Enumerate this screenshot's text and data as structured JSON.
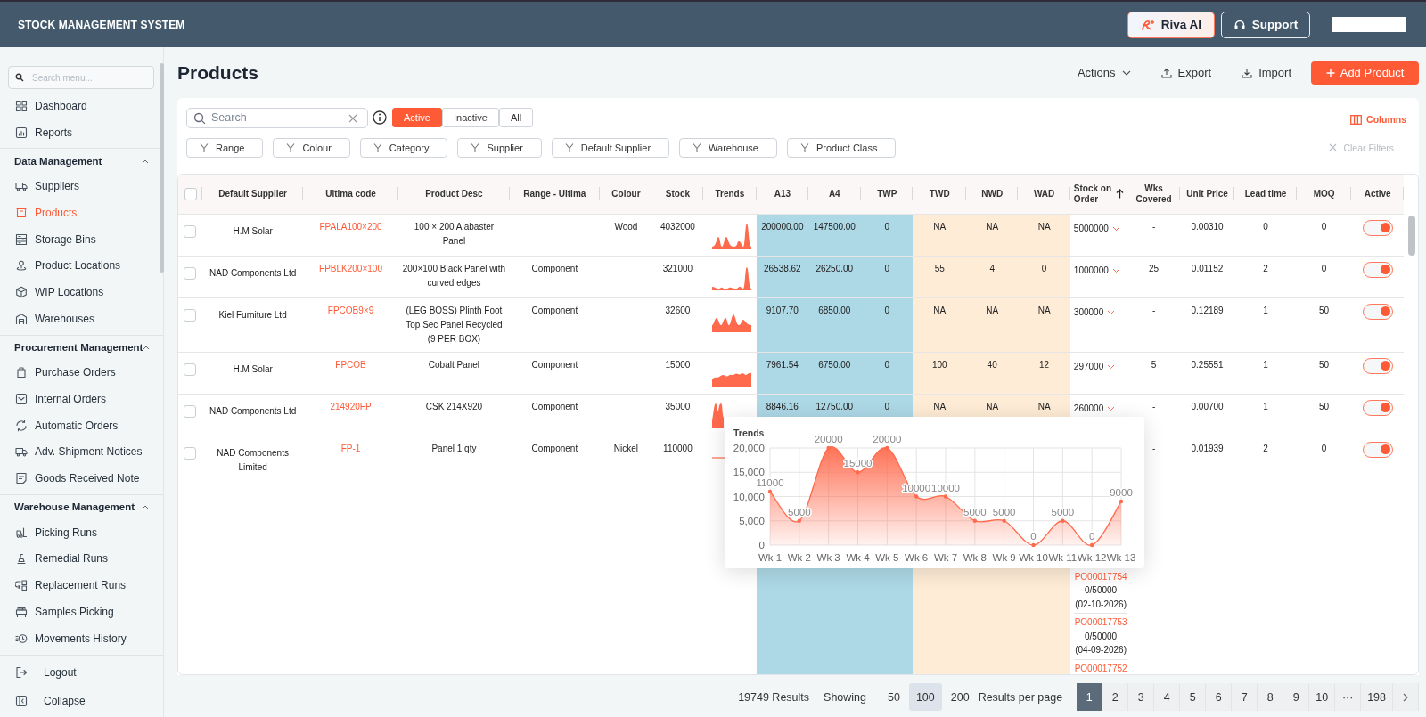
{
  "header": {
    "title": "STOCK MANAGEMENT SYSTEM",
    "buttons": [
      {
        "label": "Riva AI",
        "kind": "ai"
      },
      {
        "label": "Support",
        "kind": "support"
      }
    ]
  },
  "sidebar": {
    "search": {
      "placeholder": "Search menu..."
    },
    "items": [
      {
        "label": "Dashboard",
        "selected": false
      },
      {
        "label": "Reports",
        "selected": false
      }
    ],
    "sections": [
      {
        "title": "Data Management",
        "expanded": true,
        "items": [
          {
            "label": "Suppliers",
            "selected": false
          },
          {
            "label": "Products",
            "selected": true
          },
          {
            "label": "Storage Bins",
            "selected": false
          },
          {
            "label": "Product Locations",
            "selected": false
          },
          {
            "label": "WIP Locations",
            "selected": false
          },
          {
            "label": "Warehouses",
            "selected": false
          }
        ]
      },
      {
        "title": "Procurement Management",
        "expanded": true,
        "items": [
          {
            "label": "Purchase Orders",
            "selected": false
          },
          {
            "label": "Internal Orders",
            "selected": false
          },
          {
            "label": "Automatic Orders",
            "selected": false
          },
          {
            "label": "Adv. Shipment Notices",
            "selected": false
          },
          {
            "label": "Goods Received Note",
            "selected": false
          }
        ]
      },
      {
        "title": "Warehouse Management",
        "expanded": true,
        "items": [
          {
            "label": "Picking Runs",
            "selected": false
          },
          {
            "label": "Remedial Runs",
            "selected": false
          },
          {
            "label": "Replacement Runs",
            "selected": false
          },
          {
            "label": "Samples Picking",
            "selected": false
          },
          {
            "label": "Movements History",
            "selected": false
          }
        ]
      }
    ],
    "footer": [
      "Logout",
      "Collapse"
    ]
  },
  "page": {
    "title": "Products",
    "actions": [
      {
        "label": "Actions",
        "kind": "dropdown"
      },
      {
        "label": "Export",
        "kind": "export"
      },
      {
        "label": "Import",
        "kind": "import"
      },
      {
        "label": "Add Product",
        "kind": "primary"
      }
    ]
  },
  "filters": {
    "search": {
      "placeholder": "Search"
    },
    "status_tabs": [
      {
        "label": "Active",
        "selected": true
      },
      {
        "label": "Inactive",
        "selected": false
      },
      {
        "label": "All",
        "selected": false
      }
    ],
    "columns_label": "Columns",
    "chips": [
      "Range",
      "Colour",
      "Category",
      "Supplier",
      "Default Supplier",
      "Warehouse",
      "Product Class"
    ],
    "clear": {
      "label": "Clear Filters",
      "disabled": true
    }
  },
  "table": {
    "all_checked": false,
    "columns": [
      {
        "label": "Default Supplier",
        "kind": "text"
      },
      {
        "label": "Ultima code",
        "kind": "link"
      },
      {
        "label": "Product Desc",
        "kind": "text"
      },
      {
        "label": "Range - Ultima",
        "kind": "text"
      },
      {
        "label": "Colour",
        "kind": "text"
      },
      {
        "label": "Stock",
        "kind": "text"
      },
      {
        "label": "Trends",
        "kind": "trend"
      },
      {
        "label": "A13",
        "kind": "text",
        "color": "#add8e6"
      },
      {
        "label": "A4",
        "kind": "text",
        "color": "#add8e6"
      },
      {
        "label": "TWP",
        "kind": "text",
        "color": "#add8e6"
      },
      {
        "label": "TWD",
        "kind": "text",
        "color": "#feecd6"
      },
      {
        "label": "NWD",
        "kind": "text",
        "color": "#feecd6"
      },
      {
        "label": "WAD",
        "kind": "text",
        "color": "#feecd6"
      },
      {
        "label": "Stock on Order",
        "kind": "order",
        "sorted": true
      },
      {
        "label": "Wks Covered",
        "kind": "text"
      },
      {
        "label": "Unit Price",
        "kind": "text"
      },
      {
        "label": "Lead time",
        "kind": "text"
      },
      {
        "label": "MOQ",
        "kind": "text"
      },
      {
        "label": "Active",
        "kind": "toggle"
      }
    ],
    "rows": [
      {
        "checked": false,
        "supplier": "H.M Solar",
        "code": "FPALA100×200",
        "description": "100 × 200 Alabaster Panel",
        "colour": "Wood",
        "stock": "4032000",
        "a13": "200000.00",
        "a4": "147500.00",
        "twp": "0",
        "twd": "NA",
        "nwd": "NA",
        "wad": "NA",
        "stock_on_order": "5000000",
        "wks_covered": "-",
        "unit_price": "0.00310",
        "lead_time": "0",
        "moq": "0",
        "active": true
      },
      {
        "checked": false,
        "supplier": "NAD Components Ltd",
        "code": "FPBLK200×100",
        "description": "200×100 Black Panel with curved edges",
        "range": "Component",
        "stock": "321000",
        "a13": "26538.62",
        "a4": "26250.00",
        "twp": "0",
        "twd": "55",
        "nwd": "4",
        "wad": "0",
        "stock_on_order": "1000000",
        "wks_covered": "25",
        "unit_price": "0.01152",
        "lead_time": "2",
        "moq": "0",
        "active": true
      },
      {
        "checked": false,
        "supplier": "Kiel Furniture Ltd",
        "code": "FPCOB9×9",
        "description": "(LEG BOSS) Plinth Foot Top Sec Panel Recycled (9 PER BOX)",
        "range": "Component",
        "stock": "32600",
        "a13": "9107.70",
        "a4": "6850.00",
        "twp": "0",
        "twd": "NA",
        "nwd": "NA",
        "wad": "NA",
        "stock_on_order": "300000",
        "wks_covered": "-",
        "unit_price": "0.12189",
        "lead_time": "1",
        "moq": "50",
        "active": true
      },
      {
        "checked": false,
        "supplier": "H.M Solar",
        "code": "FPCOB",
        "description": "Cobalt Panel",
        "range": "Component",
        "stock": "15000",
        "a13": "7961.54",
        "a4": "6750.00",
        "twp": "0",
        "twd": "100",
        "nwd": "40",
        "wad": "12",
        "stock_on_order": "297000",
        "wks_covered": "5",
        "unit_price": "0.25551",
        "lead_time": "1",
        "moq": "50",
        "active": true
      },
      {
        "checked": false,
        "supplier": "NAD Components Ltd",
        "code": "214920FP",
        "description": "CSK 214X920",
        "range": "Component",
        "stock": "35000",
        "a13": "8846.16",
        "a4": "12750.00",
        "twp": "0",
        "twd": "NA",
        "nwd": "NA",
        "wad": "NA",
        "stock_on_order": "260000",
        "wks_covered": "-",
        "unit_price": "0.00700",
        "lead_time": "1",
        "moq": "50",
        "active": true
      },
      {
        "checked": false,
        "supplier": "NAD Components Limited",
        "code": "FP-1",
        "description": "Panel 1 qty",
        "range": "Component",
        "colour": "Nickel",
        "stock": "110000",
        "purchase_orders": [
          {
            "number": "PO00017754",
            "quantity": "0/50000",
            "date": "(02-10-2026)"
          },
          {
            "number": "PO00017753",
            "quantity": "0/50000",
            "date": "(04-09-2026)"
          },
          {
            "number": "PO00017752"
          }
        ],
        "wks_covered": "-",
        "unit_price": "0.01939",
        "lead_time": "2",
        "moq": "0",
        "active": true
      }
    ],
    "trend_tooltip": {
      "chart_data": {
        "type": "area",
        "grid": true,
        "categories": [
          "Wk 1",
          "Wk 2",
          "Wk 3",
          "Wk 4",
          "Wk 5",
          "Wk 6",
          "Wk 7",
          "Wk 8",
          "Wk 9",
          "Wk 10",
          "Wk 11",
          "Wk 12",
          "Wk 13"
        ],
        "series": [
          {
            "name": "Trends",
            "color": "#ff6a4d",
            "values": [
              11000,
              5000,
              20000,
              15000,
              20000,
              10000,
              10000,
              5000,
              5000,
              0,
              5000,
              0,
              9000
            ]
          }
        ],
        "ylim": [
          0,
          20000
        ],
        "yticks": [
          {
            "value": 0,
            "label": "0"
          },
          {
            "value": 5000,
            "label": "5,000"
          },
          {
            "value": 10000,
            "label": "10,000"
          },
          {
            "value": 15000,
            "label": "15,000"
          },
          {
            "value": 20000,
            "label": "20,000"
          }
        ],
        "data_labels": true
      }
    }
  },
  "pagination": {
    "total": "19749 Results",
    "showing_label": "Showing",
    "page_sizes": [
      {
        "label": "50",
        "selected": false
      },
      {
        "label": "100",
        "selected": true
      },
      {
        "label": "200",
        "selected": false
      }
    ],
    "per_page_label": "Results per page",
    "pages": [
      {
        "label": "1",
        "selected": true
      },
      {
        "label": "2",
        "selected": false
      },
      {
        "label": "3",
        "selected": false
      },
      {
        "label": "4",
        "selected": false
      },
      {
        "label": "5",
        "selected": false
      },
      {
        "label": "6",
        "selected": false
      },
      {
        "label": "7",
        "selected": false
      },
      {
        "label": "8",
        "selected": false
      },
      {
        "label": "9",
        "selected": false
      },
      {
        "label": "10",
        "selected": false
      },
      {
        "label": "···",
        "selected": false
      },
      {
        "label": "198",
        "selected": false
      }
    ]
  }
}
